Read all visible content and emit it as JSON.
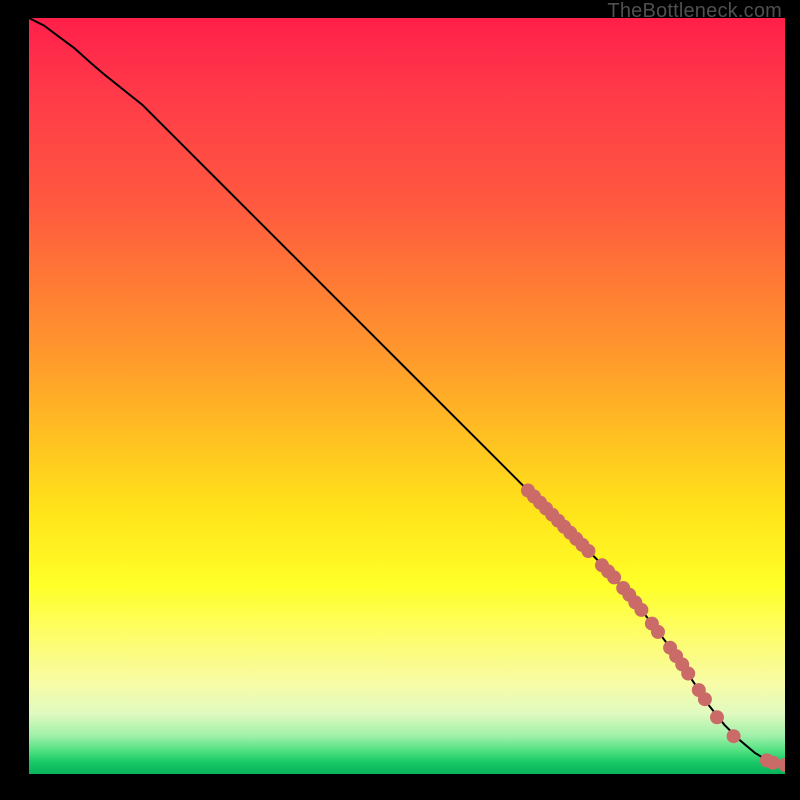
{
  "watermark": "TheBottleneck.com",
  "colors": {
    "page_bg": "#000000",
    "curve": "#000000",
    "marker_fill": "#ca6b68",
    "marker_stroke": "#b55a57"
  },
  "chart_data": {
    "type": "line",
    "title": "",
    "xlabel": "",
    "ylabel": "",
    "xlim": [
      0,
      100
    ],
    "ylim": [
      0,
      100
    ],
    "grid": false,
    "legend": false,
    "series": [
      {
        "name": "curve",
        "x": [
          0,
          2,
          4,
          6,
          8,
          10,
          15,
          20,
          25,
          30,
          35,
          40,
          45,
          50,
          55,
          60,
          65,
          70,
          75,
          80,
          85,
          88,
          90,
          92,
          94,
          96,
          98,
          100
        ],
        "y": [
          100,
          99,
          97.5,
          96,
          94.2,
          92.5,
          88.5,
          83.5,
          78.5,
          73.5,
          68.5,
          63.5,
          58.5,
          53.5,
          48.5,
          43.5,
          38.5,
          33.5,
          28.5,
          23.0,
          16.5,
          12.0,
          9.0,
          6.5,
          4.5,
          2.8,
          1.6,
          1.2
        ]
      }
    ],
    "markers": [
      {
        "x": 66.0,
        "y": 37.5
      },
      {
        "x": 66.8,
        "y": 36.7
      },
      {
        "x": 67.6,
        "y": 35.9
      },
      {
        "x": 68.4,
        "y": 35.1
      },
      {
        "x": 69.2,
        "y": 34.3
      },
      {
        "x": 70.0,
        "y": 33.5
      },
      {
        "x": 70.8,
        "y": 32.7
      },
      {
        "x": 71.6,
        "y": 31.9
      },
      {
        "x": 72.4,
        "y": 31.1
      },
      {
        "x": 73.2,
        "y": 30.3
      },
      {
        "x": 74.0,
        "y": 29.5
      },
      {
        "x": 75.8,
        "y": 27.6
      },
      {
        "x": 76.6,
        "y": 26.8
      },
      {
        "x": 77.4,
        "y": 26.0
      },
      {
        "x": 78.6,
        "y": 24.6
      },
      {
        "x": 79.4,
        "y": 23.7
      },
      {
        "x": 80.2,
        "y": 22.7
      },
      {
        "x": 81.0,
        "y": 21.7
      },
      {
        "x": 82.4,
        "y": 19.9
      },
      {
        "x": 83.2,
        "y": 18.8
      },
      {
        "x": 84.8,
        "y": 16.7
      },
      {
        "x": 85.6,
        "y": 15.6
      },
      {
        "x": 86.4,
        "y": 14.5
      },
      {
        "x": 87.2,
        "y": 13.3
      },
      {
        "x": 88.6,
        "y": 11.1
      },
      {
        "x": 89.4,
        "y": 9.9
      },
      {
        "x": 91.0,
        "y": 7.5
      },
      {
        "x": 93.2,
        "y": 5.0
      },
      {
        "x": 97.6,
        "y": 1.8
      },
      {
        "x": 98.4,
        "y": 1.5
      },
      {
        "x": 100.0,
        "y": 1.2
      }
    ],
    "marker_radius_px": 7
  }
}
